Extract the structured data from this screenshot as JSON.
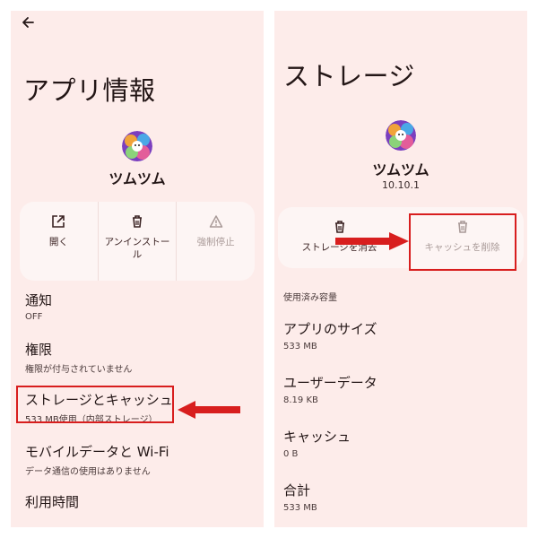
{
  "left": {
    "title": "アプリ情報",
    "icons": {
      "back": "back-arrow-icon",
      "app": "tsumtsum-app-icon"
    },
    "app_name": "ツムツム",
    "actions": [
      {
        "label": "開く",
        "icon": "open-external-icon",
        "disabled": false
      },
      {
        "label": "アンインストール",
        "icon": "trash-icon",
        "disabled": false
      },
      {
        "label": "強制停止",
        "icon": "warning-icon",
        "disabled": true
      }
    ],
    "settings": [
      {
        "title": "通知",
        "subtitle": "OFF"
      },
      {
        "title": "権限",
        "subtitle": "権限が付与されていません"
      },
      {
        "title": "ストレージとキャッシュ",
        "subtitle": "533 MB使用（内部ストレージ）"
      },
      {
        "title": "モバイルデータと Wi-Fi",
        "subtitle": "データ通信の使用はありません"
      },
      {
        "title": "利用時間",
        "subtitle": ""
      }
    ]
  },
  "right": {
    "title": "ストレージ",
    "icons": {
      "app": "tsumtsum-app-icon"
    },
    "app_name": "ツムツム",
    "version": "10.10.1",
    "actions": [
      {
        "label": "ストレージを消去",
        "icon": "trash-icon",
        "disabled": false
      },
      {
        "label": "キャッシュを削除",
        "icon": "trash-icon",
        "disabled": true
      }
    ],
    "section_header": "使用済み容量",
    "stats": [
      {
        "title": "アプリのサイズ",
        "value": "533 MB"
      },
      {
        "title": "ユーザーデータ",
        "value": "8.19 KB"
      },
      {
        "title": "キャッシュ",
        "value": "0 B"
      },
      {
        "title": "合計",
        "value": "533 MB"
      }
    ]
  },
  "annotation_color": "#d81e1e",
  "panel_background": "#fdecea"
}
